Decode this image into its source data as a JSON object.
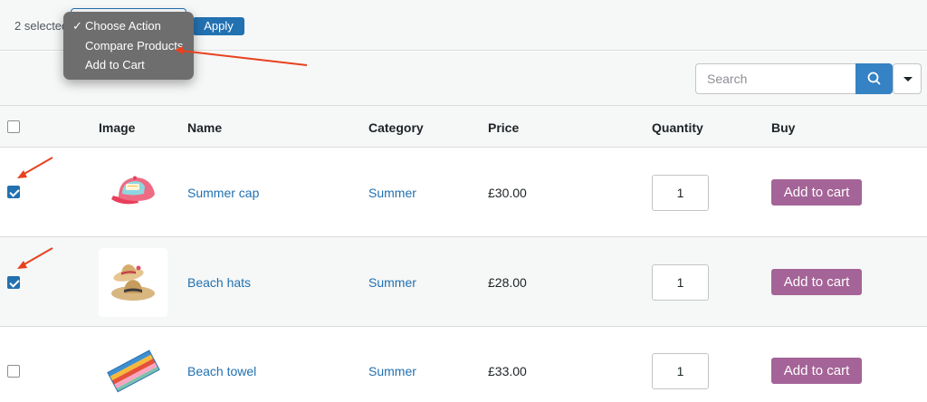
{
  "bulk": {
    "selected_text": "2 selected",
    "apply_label": "Apply",
    "dropdown": [
      {
        "label": "Choose Action",
        "checked": true
      },
      {
        "label": "Compare Products",
        "checked": false
      },
      {
        "label": "Add to Cart",
        "checked": false
      }
    ]
  },
  "search": {
    "placeholder": "Search"
  },
  "icons": {
    "search": "search-icon",
    "filter": "caret-down-icon",
    "annotation": "red-arrow-icon"
  },
  "table": {
    "headers": {
      "image": "Image",
      "name": "Name",
      "category": "Category",
      "price": "Price",
      "quantity": "Quantity",
      "buy": "Buy"
    },
    "rows": [
      {
        "name": "Summer cap",
        "category": "Summer",
        "price": "£30.00",
        "quantity": "1",
        "buy": "Add to cart",
        "checked": true,
        "image": "cap-image"
      },
      {
        "name": "Beach hats",
        "category": "Summer",
        "price": "£28.00",
        "quantity": "1",
        "buy": "Add to cart",
        "checked": true,
        "image": "hats-image"
      },
      {
        "name": "Beach towel",
        "category": "Summer",
        "price": "£33.00",
        "quantity": "1",
        "buy": "Add to cart",
        "checked": false,
        "image": "towel-image"
      }
    ]
  },
  "colors": {
    "accent": "#2271b1",
    "cart_button": "#a46497",
    "annotation": "#e8411e",
    "dropdown_bg": "#6e6e6e"
  }
}
